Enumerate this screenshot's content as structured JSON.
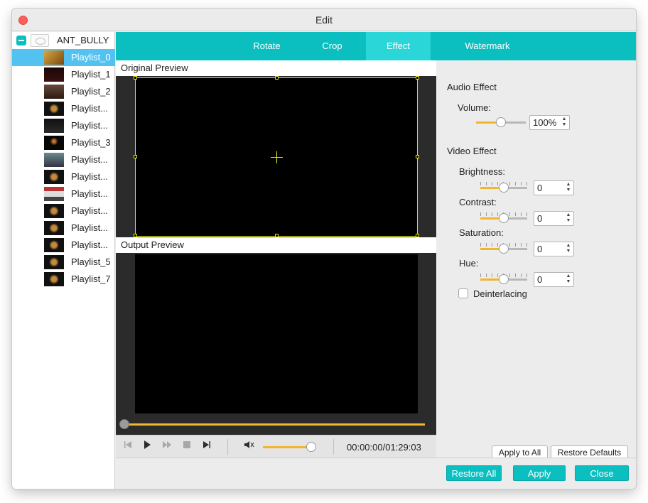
{
  "window": {
    "title": "Edit"
  },
  "sidebar": {
    "root_label": "ANT_BULLY",
    "items": [
      {
        "label": "Playlist_0",
        "selected": true
      },
      {
        "label": "Playlist_1"
      },
      {
        "label": "Playlist_2"
      },
      {
        "label": "Playlist..."
      },
      {
        "label": "Playlist..."
      },
      {
        "label": "Playlist_3"
      },
      {
        "label": "Playlist..."
      },
      {
        "label": "Playlist..."
      },
      {
        "label": "Playlist..."
      },
      {
        "label": "Playlist..."
      },
      {
        "label": "Playlist..."
      },
      {
        "label": "Playlist..."
      },
      {
        "label": "Playlist_5"
      },
      {
        "label": "Playlist_7"
      }
    ]
  },
  "tabs": [
    {
      "label": "Rotate"
    },
    {
      "label": "Crop"
    },
    {
      "label": "Effect",
      "active": true
    },
    {
      "label": "Watermark"
    }
  ],
  "preview": {
    "original_label": "Original Preview",
    "output_label": "Output Preview",
    "progress": 0
  },
  "controls": {
    "time": "00:00:00/01:29:03",
    "volume": 1.0
  },
  "effects": {
    "audio_title": "Audio Effect",
    "volume_label": "Volume:",
    "volume_value": "100%",
    "video_title": "Video Effect",
    "brightness_label": "Brightness:",
    "brightness_value": "0",
    "contrast_label": "Contrast:",
    "contrast_value": "0",
    "saturation_label": "Saturation:",
    "saturation_value": "0",
    "hue_label": "Hue:",
    "hue_value": "0",
    "deinterlacing_label": "Deinterlacing",
    "deinterlacing_checked": false,
    "apply_to_all": "Apply to All",
    "restore_defaults": "Restore Defaults"
  },
  "footer": {
    "restore_all": "Restore All",
    "apply": "Apply",
    "close": "Close"
  },
  "colors": {
    "accent": "#0bbfc0",
    "tab_active": "#2ad6d8",
    "selection": "#54c2f0",
    "slider": "#f1b62e",
    "crop_frame": "#e6e61a"
  }
}
